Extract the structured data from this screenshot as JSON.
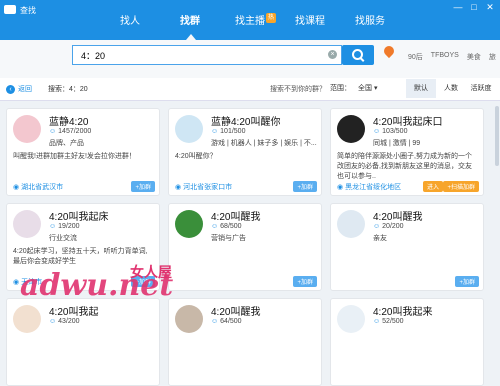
{
  "app": {
    "title": "查找"
  },
  "window": {
    "buttons": [
      "—",
      "□",
      "✕"
    ]
  },
  "nav": {
    "tabs": [
      "找人",
      "找群",
      "找主播",
      "找课程",
      "找服务"
    ],
    "active": 1,
    "hot_badge": "热"
  },
  "search": {
    "value": "4：20",
    "clear": "×"
  },
  "hot_tags": [
    "90后",
    "TFBOYS",
    "美食",
    "旅"
  ],
  "filter": {
    "back": "返回",
    "query": "搜索：4：20",
    "hint": "搜索不到你的群？",
    "location_label": "范围：",
    "location_value": "全国",
    "sorts": [
      "默认",
      "人数",
      "活跃度"
    ]
  },
  "groups": [
    {
      "name": "蓝静4:20",
      "members": "1457/2000",
      "tag": "品牌、产品",
      "desc": "叫醒我!进群加群主好友!发会拉你进群！",
      "location": "湖北省武汉市",
      "avatar_color": "#f3c7cf",
      "action": "+加群"
    },
    {
      "name": "蓝静4:20叫醒你",
      "members": "101/500",
      "tag": "游戏 | 机器人 | 妹子多 | 娱乐 | 不...",
      "desc": "4:20叫醒你？",
      "location": "河北省张家口市",
      "avatar_color": "#cfe6f4",
      "action": "+加群"
    },
    {
      "name": "4:20叫我起床口",
      "members": "103/500",
      "tag": "同城 | 激情 | 99",
      "desc": "简单的陪伴源源处小圈子,努力成为新的一个改团友的必备,找到新朋友这里的消息，交友 也可以参与..",
      "location": "黑龙江省绥化地区",
      "avatar_color": "#222222",
      "action": "进入",
      "action2": "+扫描加群"
    },
    {
      "name": "4:20叫我起床",
      "members": "19/200",
      "tag": "行业交流",
      "desc": "4:20起床学习，坚持五十天，听听力背单词,最后你会变成好学生",
      "location": "天津市",
      "avatar_color": "#e8dde8",
      "action": "+加群"
    },
    {
      "name": "4:20叫醒我",
      "members": "68/500",
      "tag": "营销与广告",
      "desc": "",
      "location": "",
      "avatar_color": "#3a8f3a",
      "action": "+加群"
    },
    {
      "name": "4:20叫醒我",
      "members": "20/200",
      "tag": "亲友",
      "desc": "",
      "location": "",
      "avatar_color": "#dfe9f2",
      "action": "+加群"
    },
    {
      "name": "4:20叫我起",
      "members": "43/200",
      "tag": "",
      "desc": "",
      "location": "",
      "avatar_color": "#f2e0d0",
      "action": ""
    },
    {
      "name": "4:20叫醒我",
      "members": "64/500",
      "tag": "",
      "desc": "",
      "location": "",
      "avatar_color": "#c8b8a8",
      "action": ""
    },
    {
      "name": "4:20叫我起来",
      "members": "52/500",
      "tag": "",
      "desc": "",
      "location": "",
      "avatar_color": "#e9f0f6",
      "action": ""
    }
  ],
  "watermark": {
    "text": "adwu.net",
    "text2": "女人屋"
  }
}
